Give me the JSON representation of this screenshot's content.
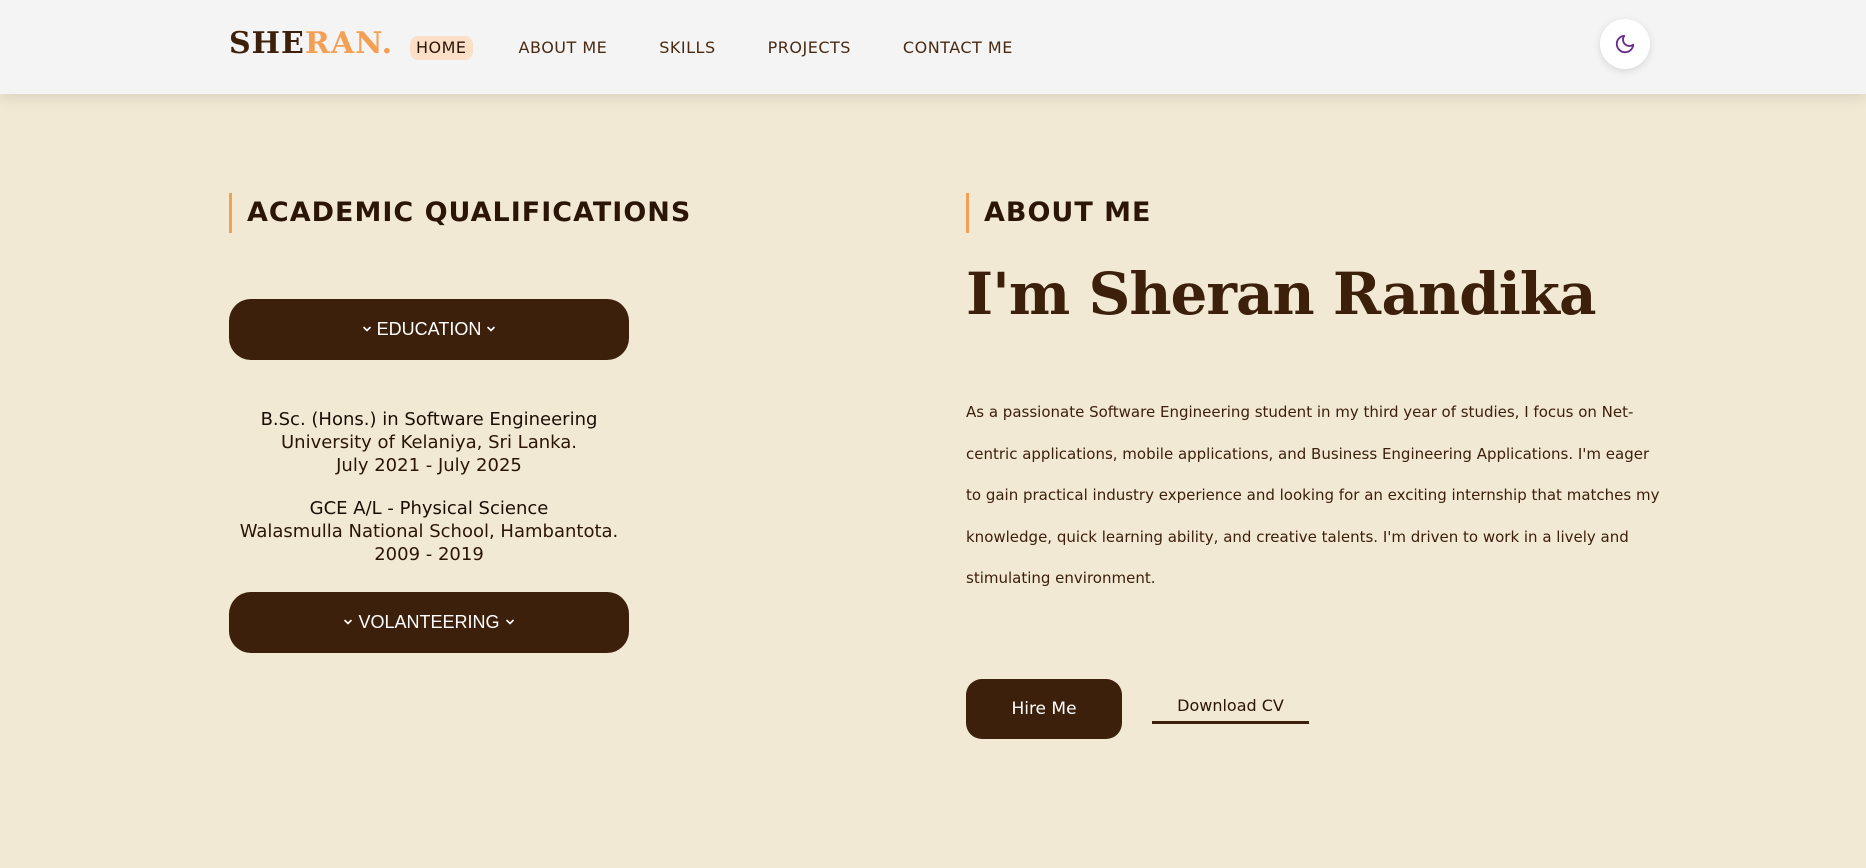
{
  "brand": {
    "logo_part1": "SHE",
    "logo_part2": "RAN."
  },
  "nav": {
    "items": [
      {
        "label": "HOME",
        "active": true
      },
      {
        "label": "ABOUT ME",
        "active": false
      },
      {
        "label": "SKILLS",
        "active": false
      },
      {
        "label": "PROJECTS",
        "active": false
      },
      {
        "label": "CONTACT ME",
        "active": false
      }
    ],
    "theme_toggle_icon": "moon-icon"
  },
  "academic": {
    "heading": "ACADEMIC QUALIFICATIONS",
    "education_button": "EDUCATION",
    "volunteering_button": "VOLANTEERING",
    "education": [
      {
        "degree": "B.Sc. (Hons.) in Software Engineering",
        "institution": "University of Kelaniya, Sri Lanka.",
        "period": "July 2021 - July 2025"
      },
      {
        "degree": "GCE A/L - Physical Science",
        "institution": "Walasmulla National School, Hambantota.",
        "period": "2009 - 2019"
      }
    ]
  },
  "about": {
    "heading": "ABOUT ME",
    "name": "I'm Sheran Randika",
    "description": "As a passionate Software Engineering student in my third year of studies, I focus on Net-centric applications, mobile applications, and Business Engineering Applications. I'm eager to gain practical industry experience and looking for an exciting internship that matches my knowledge, quick learning ability, and creative talents. I'm driven to work in a lively and stimulating environment.",
    "hire_button": "Hire Me",
    "download_button": "Download CV"
  },
  "colors": {
    "background": "#f2e9d4",
    "navbar": "#f4f4f4",
    "primary_brown": "#3d200b",
    "accent_orange": "#f3a055",
    "active_nav_bg": "#fbdfc6",
    "moon_icon": "#6a2c8c"
  }
}
